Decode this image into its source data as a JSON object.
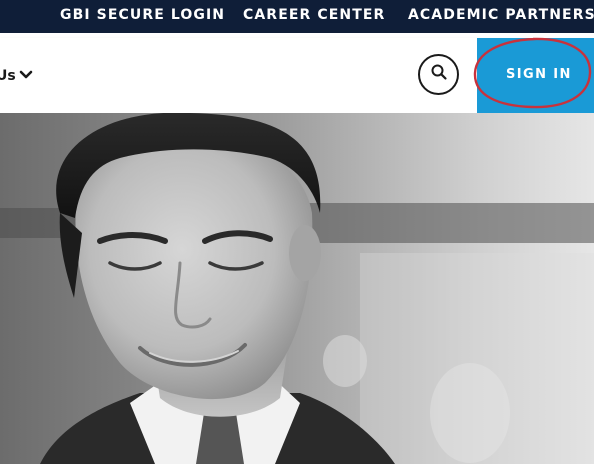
{
  "utility_nav": {
    "links": [
      {
        "label": "GBI SECURE LOGIN"
      },
      {
        "label": "CAREER CENTER"
      },
      {
        "label": "ACADEMIC PARTNERS"
      }
    ]
  },
  "main_nav": {
    "partial_item_label": "Us",
    "partial_item_icon": "chevron-down-icon",
    "search_icon": "search-icon",
    "sign_in_label": "SIGN IN"
  },
  "colors": {
    "utility_bar_bg": "#0f1e38",
    "sign_in_bg": "#1a9ad6",
    "annotation_circle": "#c8323c"
  },
  "hero": {
    "image": "black-and-white portrait of smiling man in suit"
  }
}
